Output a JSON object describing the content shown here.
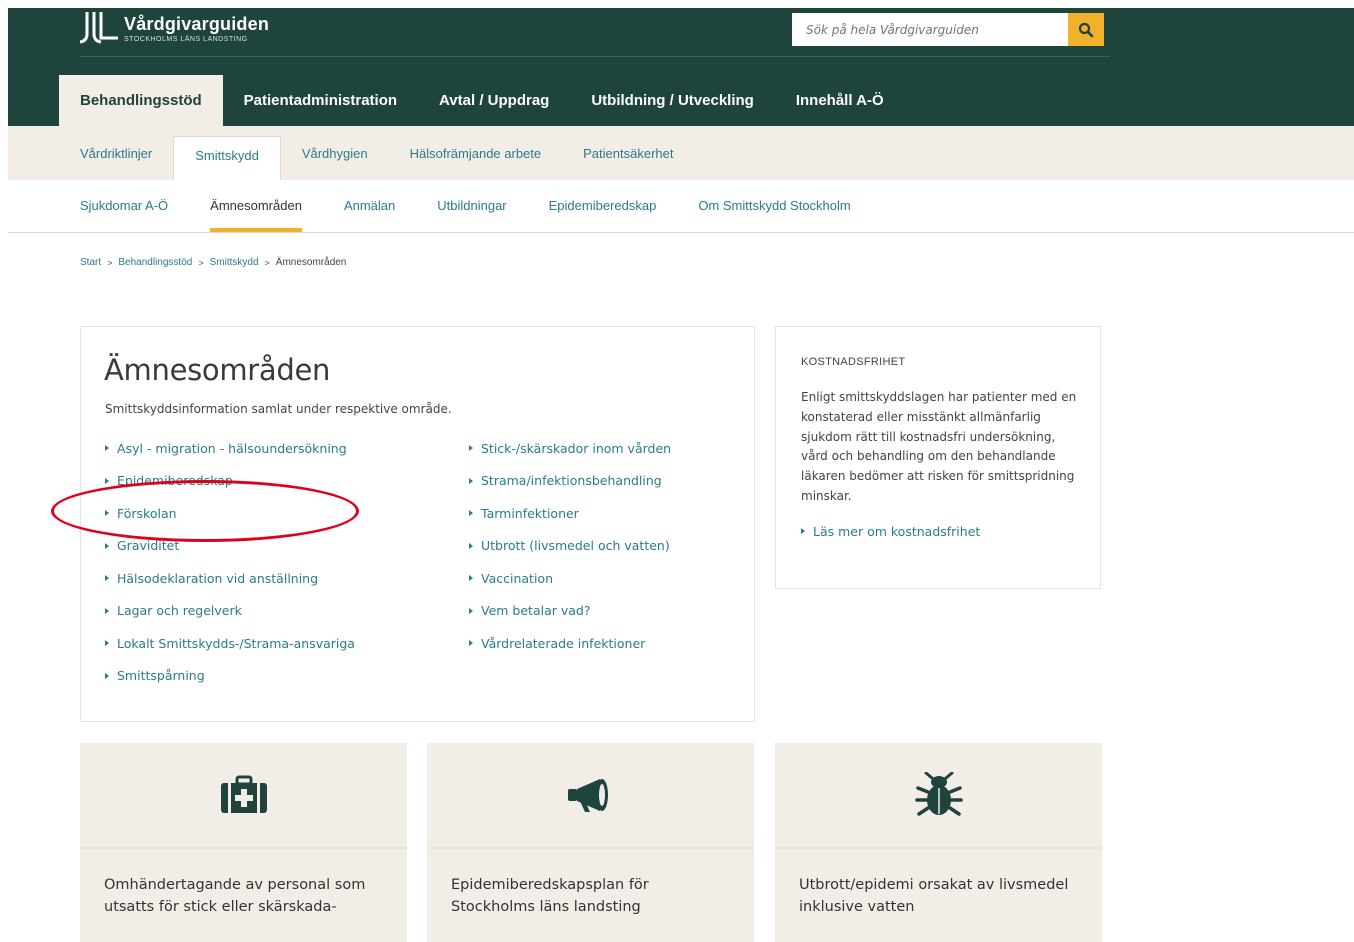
{
  "header": {
    "logo_title": "Vårdgivarguiden",
    "logo_subtitle": "STOCKHOLMS LÄNS LANDSTING",
    "search_placeholder": "Sök på hela Vårdgivarguiden",
    "main_nav": [
      "Behandlingsstöd",
      "Patientadministration",
      "Avtal / Uppdrag",
      "Utbildning / Utveckling",
      "Innehåll A-Ö"
    ],
    "main_nav_active": "Behandlingsstöd"
  },
  "subnav": {
    "items": [
      "Vårdriktlinjer",
      "Smittskydd",
      "Vårdhygien",
      "Hälsofrämjande arbete",
      "Patientsäkerhet"
    ],
    "active": "Smittskydd"
  },
  "thirdnav": {
    "items": [
      "Sjukdomar A-Ö",
      "Ämnesområden",
      "Anmälan",
      "Utbildningar",
      "Epidemiberedskap",
      "Om Smittskydd Stockholm"
    ],
    "active": "Ämnesområden"
  },
  "breadcrumb": {
    "items": [
      "Start",
      "Behandlingsstöd",
      "Smittskydd",
      "Ämnesområden"
    ],
    "separator": ">"
  },
  "main": {
    "title": "Ämnesområden",
    "intro": "Smittskyddsinformation samlat under respektive område.",
    "left_links": [
      "Asyl - migration - hälsoundersökning",
      "Epidemiberedskap",
      "Förskolan",
      "Graviditet",
      "Hälsodeklaration vid anställning",
      "Lagar och regelverk",
      "Lokalt Smittskydds-/Strama-ansvariga",
      "Smittspårning"
    ],
    "right_links": [
      "Stick-/skärskador inom vården",
      "Strama/infektionsbehandling",
      "Tarminfektioner",
      "Utbrott (livsmedel och vatten)",
      "Vaccination",
      "Vem betalar vad?",
      "Vårdrelaterade infektioner"
    ]
  },
  "sidebox": {
    "title": "KOSTNADSFRIHET",
    "body": "Enligt smittskyddslagen har patienter med en konstaterad eller misstänkt allmänfarlig sjukdom rätt till kostnadsfri undersökning, vård och behandling om den behandlande läkaren bedömer att risken för smittspridning minskar.",
    "link": "Läs mer om kostnadsfrihet"
  },
  "cards": [
    {
      "icon": "medkit-icon",
      "text": "Omhändertagande av personal som utsatts för stick eller skärskada-"
    },
    {
      "icon": "megaphone-icon",
      "text": "Epidemiberedskapsplan för Stockholms läns landsting"
    },
    {
      "icon": "bug-icon",
      "text": "Utbrott/epidemi orsakat av livsmedel inklusive vatten"
    }
  ],
  "colors": {
    "header_bg": "#1f443d",
    "accent": "#f0b12b",
    "link": "#2a7c8a",
    "tab_bg": "#f3ede7",
    "highlight": "#e0001b"
  }
}
